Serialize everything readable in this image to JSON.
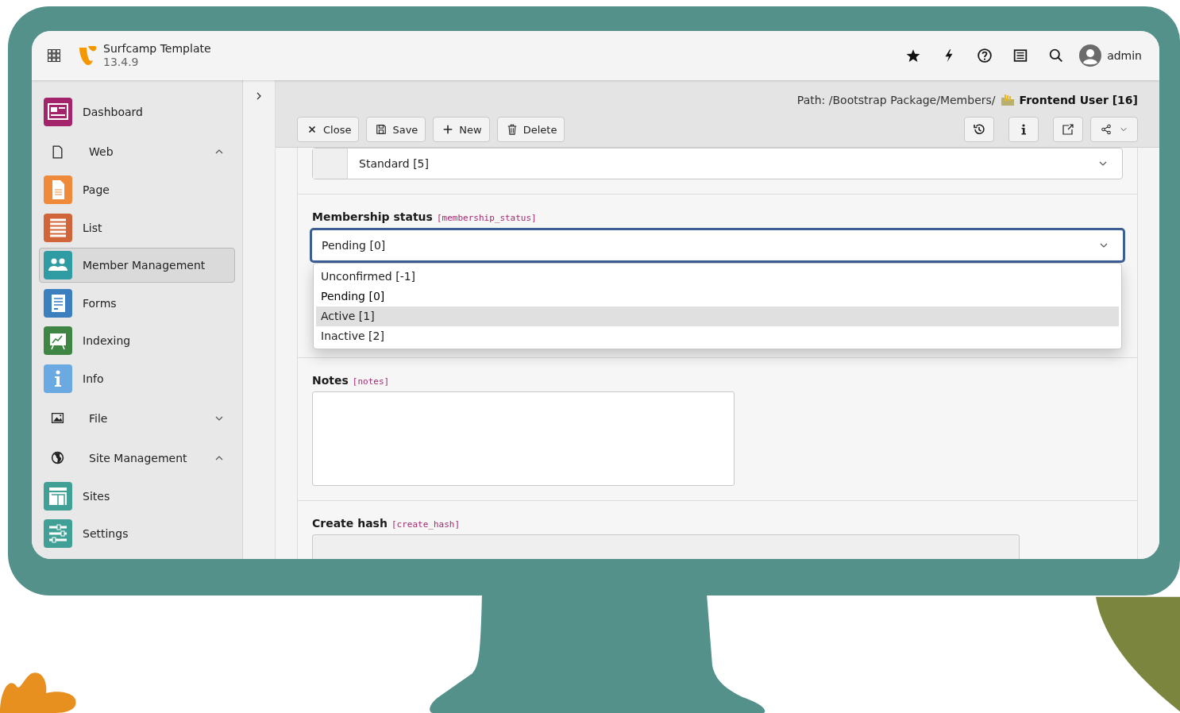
{
  "topbar": {
    "site_name": "Surfcamp Template",
    "version": "13.4.9",
    "user": "admin"
  },
  "sidebar": {
    "items": [
      {
        "kind": "module",
        "label": "Dashboard",
        "color": "#a3246a",
        "selected": false
      },
      {
        "kind": "group",
        "label": "Web",
        "expanded": true,
        "children": [
          {
            "kind": "module",
            "label": "Page",
            "color": "#ef8a3a",
            "selected": false
          },
          {
            "kind": "module",
            "label": "List",
            "color": "#d0653a",
            "selected": false
          },
          {
            "kind": "module",
            "label": "Member Management",
            "color": "#2f9ca3",
            "selected": true
          },
          {
            "kind": "module",
            "label": "Forms",
            "color": "#3b7fbf",
            "selected": false
          },
          {
            "kind": "module",
            "label": "Indexing",
            "color": "#3f8544",
            "selected": false
          },
          {
            "kind": "module",
            "label": "Info",
            "color": "#6ba9e3",
            "selected": false
          }
        ]
      },
      {
        "kind": "group",
        "label": "File",
        "expanded": false
      },
      {
        "kind": "group",
        "label": "Site Management",
        "expanded": true,
        "children": [
          {
            "kind": "module",
            "label": "Sites",
            "color": "#41a095",
            "selected": false
          },
          {
            "kind": "module",
            "label": "Settings",
            "color": "#41a095",
            "selected": false
          }
        ]
      }
    ]
  },
  "docheader": {
    "path": "Path: /Bootstrap Package/Members/",
    "record": "Frontend User [16]",
    "buttons": [
      "Close",
      "Save",
      "New",
      "Delete"
    ]
  },
  "form": {
    "fields": [
      {
        "kind": "select",
        "value": "Standard [5]"
      },
      {
        "kind": "select",
        "label": "Membership status",
        "field": "[membership_status]",
        "value": "Pending [0]",
        "open": true,
        "options": [
          {
            "label": "Unconfirmed [-1]",
            "selected": false,
            "highlighted": false
          },
          {
            "label": "Pending [0]",
            "selected": true,
            "highlighted": false
          },
          {
            "label": "Active [1]",
            "selected": false,
            "highlighted": true
          },
          {
            "label": "Inactive [2]",
            "selected": false,
            "highlighted": false
          }
        ]
      },
      {
        "kind": "textarea",
        "label": "Notes",
        "field": "[notes]"
      },
      {
        "kind": "input",
        "label": "Create hash",
        "field": "[create_hash]",
        "disabled": true
      }
    ]
  }
}
